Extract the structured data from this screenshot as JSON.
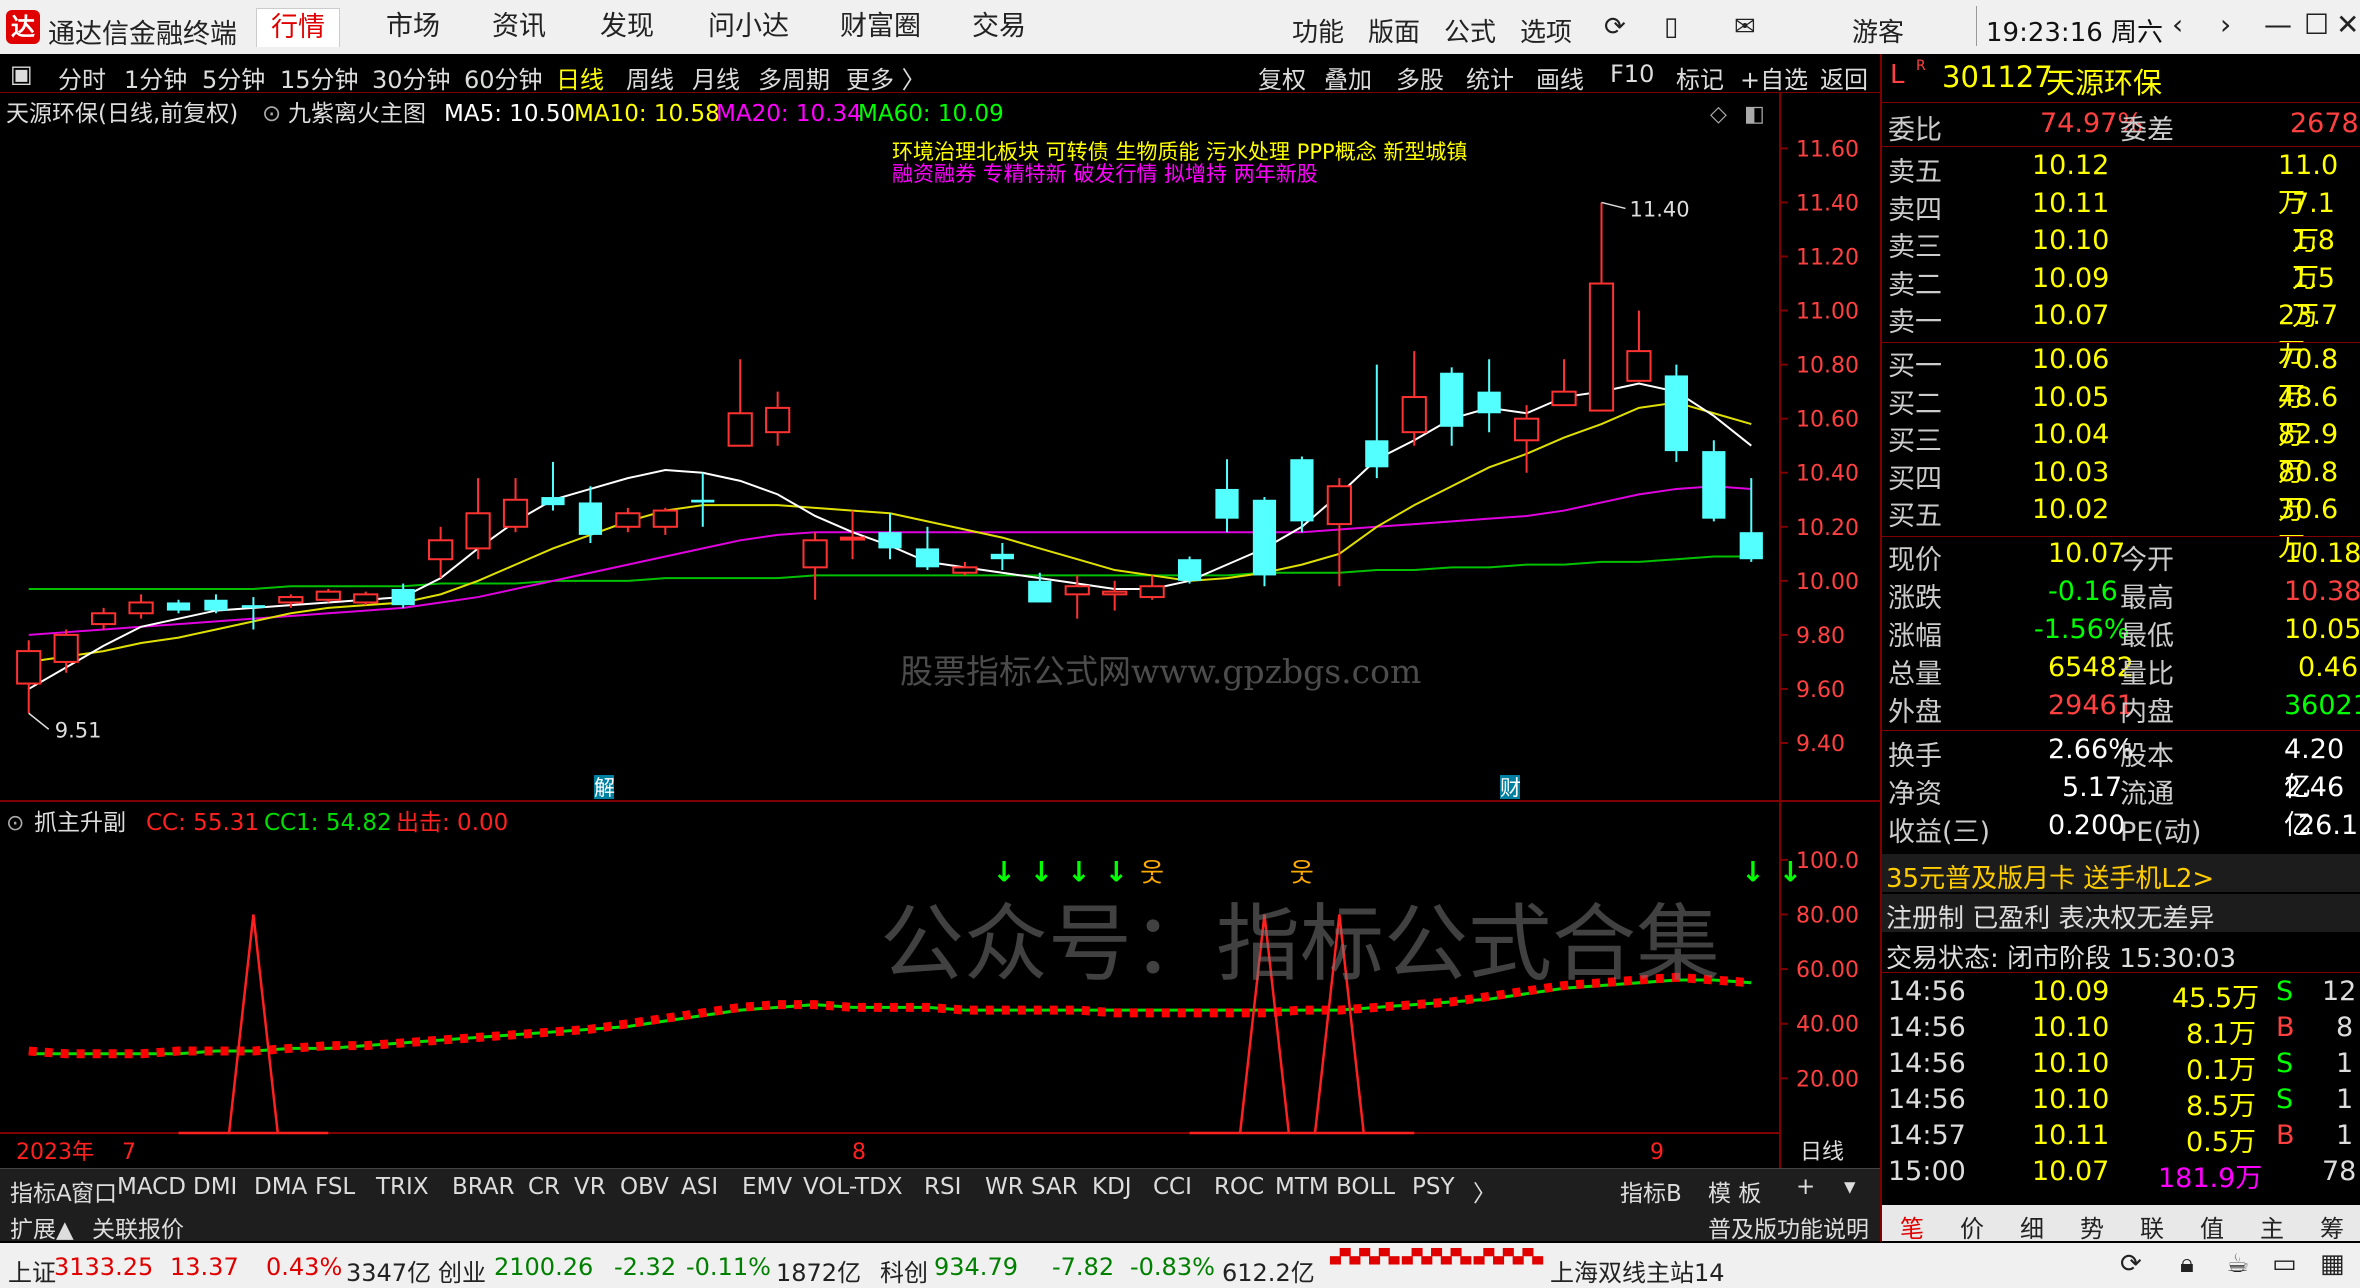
{
  "app": {
    "title": "通达信金融终端",
    "logo_text": "达"
  },
  "nav": [
    "行情",
    "市场",
    "资讯",
    "发现",
    "问小达",
    "财富圈",
    "交易"
  ],
  "right_nav": [
    "功能",
    "版面",
    "公式",
    "选项"
  ],
  "user": "游客",
  "clock": "19:23:16 周六",
  "period_tabs": [
    "分时",
    "1分钟",
    "5分钟",
    "15分钟",
    "30分钟",
    "60分钟",
    "日线",
    "周线",
    "月线",
    "多周期",
    "更多 〉"
  ],
  "active_period": "日线",
  "tool_buttons": [
    "复权",
    "叠加",
    "多股",
    "统计",
    "画线",
    "F10",
    "标记",
    "+自选",
    "返回"
  ],
  "main_chart": {
    "title": "天源环保(日线,前复权)",
    "indicator": "九紫离火主图",
    "ma": [
      {
        "label": "MA5: 10.50",
        "color": "#ffffff"
      },
      {
        "label": "MA10: 10.58",
        "color": "#ffff00"
      },
      {
        "label": "MA20: 10.34",
        "color": "#ff00ff"
      },
      {
        "label": "MA60: 10.09",
        "color": "#00ff00"
      }
    ],
    "concepts1": "环境治理北板块 可转债 生物质能 污水处理 PPP概念 新型城镇",
    "concepts2": "融资融券 专精特新 破发行情 拟增持 两年新股",
    "high_label": "11.40",
    "low_label": "9.51",
    "watermark": "股票指标公式网www.gpzbgs.com",
    "marker_jie": "解",
    "marker_cai": "财",
    "y_ticks": [
      "11.60",
      "11.40",
      "11.20",
      "11.00",
      "10.80",
      "10.60",
      "10.40",
      "10.20",
      "10.00",
      "9.80",
      "9.60",
      "9.40"
    ]
  },
  "candles": [
    [
      9.62,
      9.74,
      9.78,
      9.51
    ],
    [
      9.7,
      9.8,
      9.82,
      9.66
    ],
    [
      9.84,
      9.88,
      9.9,
      9.82
    ],
    [
      9.88,
      9.92,
      9.95,
      9.86
    ],
    [
      9.92,
      9.89,
      9.93,
      9.88
    ],
    [
      9.93,
      9.89,
      9.95,
      9.88
    ],
    [
      9.91,
      9.9,
      9.94,
      9.82
    ],
    [
      9.92,
      9.94,
      9.95,
      9.9
    ],
    [
      9.93,
      9.96,
      9.97,
      9.92
    ],
    [
      9.92,
      9.95,
      9.96,
      9.91
    ],
    [
      9.97,
      9.91,
      9.99,
      9.9
    ],
    [
      10.08,
      10.15,
      10.2,
      10.01
    ],
    [
      10.12,
      10.25,
      10.38,
      10.08
    ],
    [
      10.2,
      10.3,
      10.38,
      10.18
    ],
    [
      10.31,
      10.28,
      10.44,
      10.26
    ],
    [
      10.29,
      10.17,
      10.35,
      10.14
    ],
    [
      10.2,
      10.25,
      10.27,
      10.18
    ],
    [
      10.2,
      10.26,
      10.27,
      10.17
    ],
    [
      10.3,
      10.29,
      10.4,
      10.2
    ],
    [
      10.5,
      10.62,
      10.82,
      10.5
    ],
    [
      10.55,
      10.64,
      10.7,
      10.5
    ],
    [
      10.05,
      10.15,
      10.18,
      9.93
    ],
    [
      10.16,
      10.16,
      10.26,
      10.08
    ],
    [
      10.18,
      10.12,
      10.25,
      10.08
    ],
    [
      10.12,
      10.05,
      10.2,
      10.04
    ],
    [
      10.03,
      10.05,
      10.07,
      10.02
    ],
    [
      10.1,
      10.08,
      10.14,
      10.04
    ],
    [
      10.0,
      9.92,
      10.03,
      9.92
    ],
    [
      9.95,
      9.98,
      10.02,
      9.86
    ],
    [
      9.95,
      9.96,
      10.0,
      9.89
    ],
    [
      9.94,
      9.98,
      10.02,
      9.93
    ],
    [
      10.08,
      10.0,
      10.09,
      9.99
    ],
    [
      10.34,
      10.23,
      10.45,
      10.18
    ],
    [
      10.3,
      10.02,
      10.31,
      9.98
    ],
    [
      10.45,
      10.22,
      10.46,
      10.18
    ],
    [
      10.21,
      10.35,
      10.38,
      9.98
    ],
    [
      10.52,
      10.42,
      10.8,
      10.38
    ],
    [
      10.55,
      10.68,
      10.85,
      10.5
    ],
    [
      10.77,
      10.57,
      10.79,
      10.5
    ],
    [
      10.7,
      10.62,
      10.82,
      10.55
    ],
    [
      10.52,
      10.6,
      10.65,
      10.4
    ],
    [
      10.65,
      10.7,
      10.82,
      10.65
    ],
    [
      10.63,
      11.1,
      11.4,
      10.8
    ],
    [
      10.74,
      10.85,
      11.0,
      10.76
    ],
    [
      10.76,
      10.48,
      10.8,
      10.44
    ],
    [
      10.48,
      10.23,
      10.52,
      10.22
    ],
    [
      10.18,
      10.08,
      10.38,
      10.07
    ]
  ],
  "ma5": [
    9.6,
    9.68,
    9.76,
    9.83,
    9.86,
    9.89,
    9.9,
    9.91,
    9.92,
    9.93,
    9.94,
    10.01,
    10.12,
    10.22,
    10.3,
    10.34,
    10.38,
    10.41,
    10.4,
    10.37,
    10.32,
    10.24,
    10.18,
    10.13,
    10.07,
    10.05,
    10.03,
    10.01,
    9.99,
    9.97,
    9.97,
    10.0,
    10.06,
    10.12,
    10.2,
    10.32,
    10.45,
    10.52,
    10.6,
    10.64,
    10.62,
    10.68,
    10.7,
    10.73,
    10.7,
    10.61,
    10.5
  ],
  "ma10": [
    9.7,
    9.72,
    9.74,
    9.77,
    9.79,
    9.82,
    9.85,
    9.88,
    9.9,
    9.91,
    9.92,
    9.95,
    10.0,
    10.06,
    10.12,
    10.17,
    10.22,
    10.26,
    10.28,
    10.28,
    10.28,
    10.27,
    10.26,
    10.25,
    10.22,
    10.19,
    10.16,
    10.12,
    10.08,
    10.04,
    10.02,
    10.0,
    10.01,
    10.03,
    10.06,
    10.1,
    10.2,
    10.28,
    10.35,
    10.42,
    10.47,
    10.53,
    10.58,
    10.64,
    10.66,
    10.62,
    10.58
  ],
  "ma20": [
    9.8,
    9.81,
    9.82,
    9.83,
    9.84,
    9.85,
    9.86,
    9.87,
    9.88,
    9.89,
    9.9,
    9.92,
    9.94,
    9.97,
    10.0,
    10.03,
    10.06,
    10.09,
    10.12,
    10.15,
    10.17,
    10.18,
    10.18,
    10.18,
    10.18,
    10.18,
    10.18,
    10.18,
    10.18,
    10.18,
    10.18,
    10.18,
    10.18,
    10.18,
    10.18,
    10.19,
    10.2,
    10.21,
    10.22,
    10.23,
    10.24,
    10.26,
    10.29,
    10.32,
    10.34,
    10.35,
    10.34
  ],
  "ma60": [
    9.97,
    9.97,
    9.97,
    9.97,
    9.97,
    9.97,
    9.97,
    9.98,
    9.98,
    9.98,
    9.98,
    9.99,
    9.99,
    9.99,
    10.0,
    10.0,
    10.0,
    10.01,
    10.01,
    10.01,
    10.01,
    10.02,
    10.02,
    10.02,
    10.02,
    10.02,
    10.02,
    10.02,
    10.02,
    10.02,
    10.02,
    10.02,
    10.02,
    10.03,
    10.03,
    10.03,
    10.04,
    10.04,
    10.05,
    10.05,
    10.06,
    10.06,
    10.07,
    10.07,
    10.08,
    10.09,
    10.09
  ],
  "sub_chart": {
    "name": "抓主升副",
    "cc": "CC: 55.31",
    "cc1": "CC1: 54.82",
    "out": "出击: 0.00",
    "watermark": "公众号：指标公式合集",
    "y_ticks": [
      "100.0",
      "80.00",
      "60.00",
      "40.00",
      "20.00"
    ],
    "year": "2023年",
    "months": [
      "7",
      "8",
      "9"
    ],
    "signals": [
      "↓",
      "↓",
      "↓",
      "↓",
      "↓",
      "↓"
    ],
    "spikes": [
      {
        "i": 6,
        "v": 80
      },
      {
        "i": 33,
        "v": 80
      },
      {
        "i": 35,
        "v": 80
      }
    ]
  },
  "cc_values": [
    30,
    29,
    29,
    29,
    30,
    30,
    30,
    31,
    32,
    32,
    33,
    34,
    35,
    36,
    37,
    38,
    40,
    42,
    44,
    46,
    47,
    47,
    46,
    46,
    46,
    45,
    45,
    45,
    45,
    44,
    44,
    44,
    44,
    44,
    45,
    45,
    46,
    47,
    48,
    50,
    52,
    54,
    55,
    56,
    57,
    56,
    55
  ],
  "cc1_values": [
    29,
    29,
    29,
    29,
    29,
    30,
    30,
    31,
    31,
    32,
    33,
    34,
    35,
    36,
    37,
    38,
    39,
    41,
    43,
    45,
    46,
    47,
    46,
    46,
    46,
    45,
    45,
    45,
    45,
    45,
    45,
    45,
    45,
    45,
    45,
    45,
    46,
    47,
    48,
    49,
    51,
    53,
    54,
    55,
    56,
    56,
    55
  ],
  "stock": {
    "flag": "L",
    "code": "301127",
    "name": "天源环保",
    "wb_label": "委比",
    "wb": "74.97%",
    "wc_label": "委差",
    "wc": "2678",
    "asks": [
      [
        "卖五",
        "10.12",
        "11.0万"
      ],
      [
        "卖四",
        "10.11",
        "7.1万"
      ],
      [
        "卖三",
        "10.10",
        "1.8万"
      ],
      [
        "卖二",
        "10.09",
        "1.5万"
      ],
      [
        "卖一",
        "10.07",
        "23.7万"
      ]
    ],
    "bids": [
      [
        "买一",
        "10.06",
        "70.8万"
      ],
      [
        "买二",
        "10.05",
        "48.6万"
      ],
      [
        "买三",
        "10.04",
        "82.9万"
      ],
      [
        "买四",
        "10.03",
        "80.8万"
      ],
      [
        "买五",
        "10.02",
        "30.6万"
      ]
    ],
    "quote": [
      [
        "现价",
        "10.07",
        "今开",
        "10.18"
      ],
      [
        "涨跌",
        "-0.16",
        "最高",
        "10.38"
      ],
      [
        "涨幅",
        "-1.56%",
        "最低",
        "10.05"
      ],
      [
        "总量",
        "65482",
        "量比",
        "0.46"
      ],
      [
        "外盘",
        "29461",
        "内盘",
        "36021"
      ]
    ],
    "fund": [
      [
        "换手",
        "2.66%",
        "股本",
        "4.20亿"
      ],
      [
        "净资",
        "5.17",
        "流通",
        "2.46亿"
      ],
      [
        "收益(三)",
        "0.200",
        "PE(动)",
        "26.1"
      ]
    ],
    "ad": "35元普及版月卡 送手机L2>",
    "tags": "注册制 已盈利 表决权无差异",
    "trade_state": "交易状态: 闭市阶段 15:30:03",
    "ticks": [
      [
        "14:56",
        "10.09",
        "45.5万",
        "S",
        "12"
      ],
      [
        "14:56",
        "10.10",
        "8.1万",
        "B",
        "8"
      ],
      [
        "14:56",
        "10.10",
        "0.1万",
        "S",
        "1"
      ],
      [
        "14:56",
        "10.10",
        "8.5万",
        "S",
        "1"
      ],
      [
        "14:57",
        "10.11",
        "0.5万",
        "B",
        "1"
      ],
      [
        "15:00",
        "10.07",
        "181.9万",
        "",
        "78"
      ]
    ]
  },
  "indicator_tabs": [
    "指标A",
    "窗口",
    "MACD",
    "DMI",
    "DMA",
    "FSL",
    "TRIX",
    "BRAR",
    "CR",
    "VR",
    "OBV",
    "ASI",
    "EMV",
    "VOL-TDX",
    "RSI",
    "WR",
    "SAR",
    "KDJ",
    "CCI",
    "ROC",
    "MTM",
    "BOLL",
    "PSY"
  ],
  "indicator_b": "指标B",
  "template": "模 板",
  "dayline": "日线",
  "bottom_tabs": [
    "扩展▲",
    "关联报价"
  ],
  "help": "普及版功能说明",
  "right_tabs": [
    "笔",
    "价",
    "细",
    "势",
    "联",
    "值",
    "主",
    "筹"
  ],
  "status": {
    "sh_label": "上证",
    "sh": "3133.25",
    "sh_chg": "13.37",
    "sh_pct": "0.43%",
    "sh_amt": "3347亿",
    "cy_label": "创业",
    "cy": "2100.26",
    "cy_chg": "-2.32",
    "cy_pct": "-0.11%",
    "cy_amt": "1872亿",
    "kc_label": "科创",
    "kc": "934.79",
    "kc_chg": "-7.82",
    "kc_pct": "-0.83%",
    "kc_amt": "612.2亿",
    "server": "上海双线主站14"
  }
}
